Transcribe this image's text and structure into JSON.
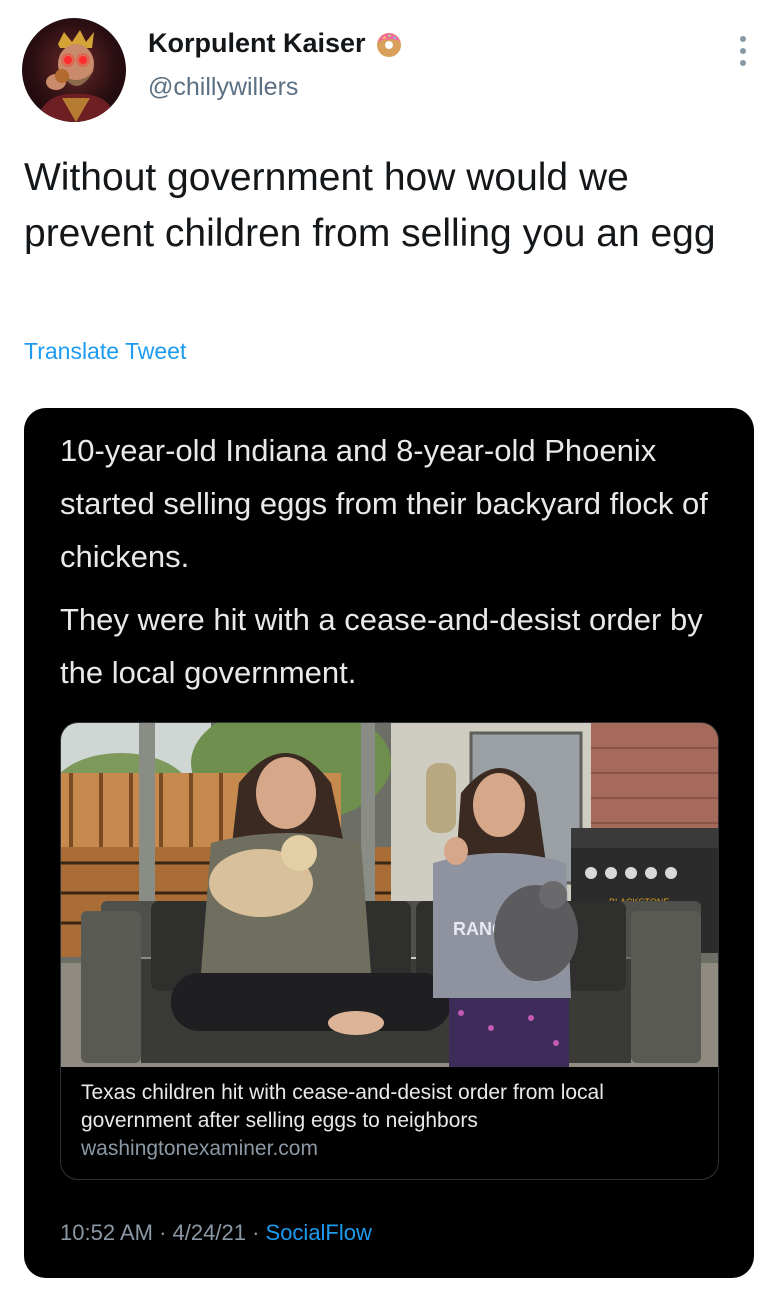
{
  "author": {
    "display_name": "Korpulent Kaiser",
    "handle": "@chillywillers",
    "badge_icon": "donut-icon",
    "avatar_icon": "crowned-figure-avatar"
  },
  "menu": {
    "icon": "more-vertical-icon"
  },
  "tweet": {
    "text": "Without government how would we prevent children from selling you an egg",
    "translate_label": "Translate Tweet"
  },
  "quoted_image": {
    "paragraph_1": "10-year-old Indiana and 8-year-old Phoenix started selling eggs from their backyard flock of chickens.",
    "paragraph_2": "They were hit with a cease-and-desist order by the local government.",
    "link_card": {
      "title": "Texas children hit with cease-and-desist order from local government after selling eggs to neighbors",
      "domain": "washingtonexaminer.com",
      "grill_brand": "BLACKSTONE",
      "shirt_text": "RANG"
    }
  },
  "meta": {
    "time": "10:52 AM",
    "separator": "·",
    "date": "4/24/21",
    "source": "SocialFlow"
  },
  "colors": {
    "link": "#1d9bf0",
    "secondary_text": "#5b7083",
    "card_bg": "#000000"
  }
}
